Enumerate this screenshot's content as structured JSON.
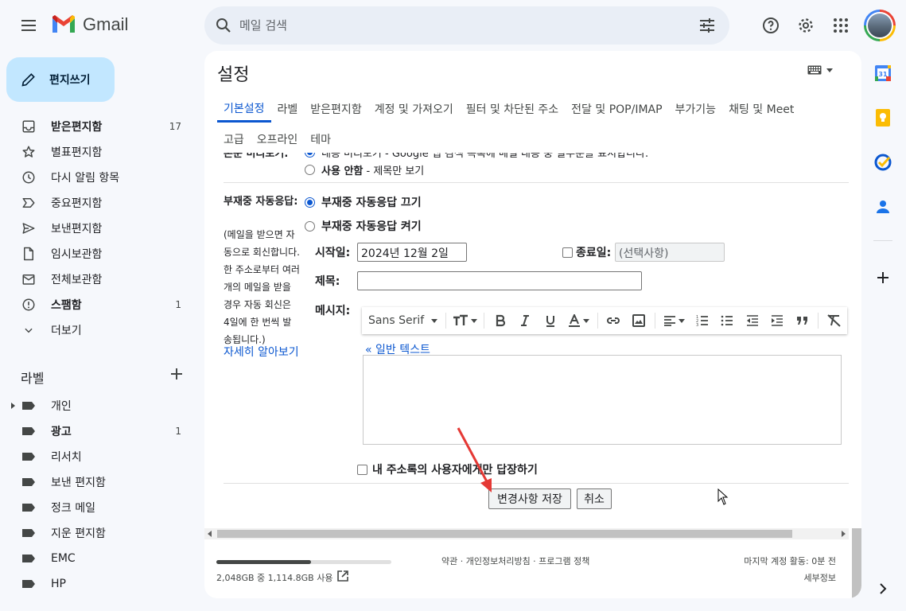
{
  "app": {
    "name": "Gmail"
  },
  "search": {
    "placeholder": "메일 검색"
  },
  "compose": {
    "label": "편지쓰기"
  },
  "nav": [
    {
      "label": "받은편지함",
      "count": "17",
      "bold": true,
      "icon": "inbox-icon"
    },
    {
      "label": "별표편지함",
      "count": "",
      "bold": false,
      "icon": "star-icon"
    },
    {
      "label": "다시 알림 항목",
      "count": "",
      "bold": false,
      "icon": "clock-icon"
    },
    {
      "label": "중요편지함",
      "count": "",
      "bold": false,
      "icon": "important-icon"
    },
    {
      "label": "보낸편지함",
      "count": "",
      "bold": false,
      "icon": "send-icon"
    },
    {
      "label": "임시보관함",
      "count": "",
      "bold": false,
      "icon": "draft-icon"
    },
    {
      "label": "전체보관함",
      "count": "",
      "bold": false,
      "icon": "all-mail-icon"
    },
    {
      "label": "스팸함",
      "count": "1",
      "bold": true,
      "icon": "spam-icon"
    },
    {
      "label": "더보기",
      "count": "",
      "bold": false,
      "icon": "chevron-down-icon"
    }
  ],
  "labels": {
    "heading": "라벨",
    "items": [
      {
        "label": "개인",
        "count": "",
        "bold": false,
        "caret": true
      },
      {
        "label": "광고",
        "count": "1",
        "bold": true,
        "caret": false
      },
      {
        "label": "리서치",
        "count": "",
        "bold": false,
        "caret": false
      },
      {
        "label": "보낸 편지함",
        "count": "",
        "bold": false,
        "caret": false
      },
      {
        "label": "정크 메일",
        "count": "",
        "bold": false,
        "caret": false
      },
      {
        "label": "지운 편지함",
        "count": "",
        "bold": false,
        "caret": false
      },
      {
        "label": "EMC",
        "count": "",
        "bold": false,
        "caret": false
      },
      {
        "label": "HP",
        "count": "",
        "bold": false,
        "caret": false
      }
    ]
  },
  "settings": {
    "title": "설정",
    "tabs_row1": [
      "기본설정",
      "라벨",
      "받은편지함",
      "계정 및 가져오기",
      "필터 및 차단된 주소",
      "전달 및 POP/IMAP",
      "부가기능",
      "채팅 및 Meet"
    ],
    "tabs_row2": [
      "고급",
      "오프라인",
      "테마"
    ],
    "active_tab": "기본설정",
    "preview_partial_label": "본문 미리보기:",
    "preview_on_text": "내용 미리보기 - Google 앱 검색 목록에 메일 내용 중 일부분을 표시합니다.",
    "preview_off_bold": "사용 안함",
    "preview_off_rest": " - 제목만 보기",
    "vacation": {
      "label": "부재중 자동응답:",
      "description": "(메일을 받으면 자동으로 회신합니다. 한 주소로부터 여러 개의 메일을 받을 경우 자동 회신은 4일에 한 번씩 발송됩니다.)",
      "learn_more": "자세히 알아보기",
      "off_option": "부재중 자동응답 끄기",
      "on_option": "부재중 자동응답 켜기",
      "start_label": "시작일:",
      "start_value": "2024년 12월 2일",
      "end_label": "종료일:",
      "end_placeholder": "(선택사항)",
      "subject_label": "제목:",
      "message_label": "메시지:",
      "font": "Sans Serif",
      "plain_text_link": "« 일반 텍스트",
      "contacts_only": "내 주소록의 사용자에게만 답장하기"
    },
    "save_button": "변경사항 저장",
    "cancel_button": "취소"
  },
  "footer": {
    "storage_fraction": 0.54,
    "storage_text": "2,048GB 중 1,114.8GB 사용",
    "links": "약관 · 개인정보처리방침 · 프로그램 정책",
    "last_activity": "마지막 계정 활동: 0분 전",
    "details": "세부정보"
  },
  "colors": {
    "accent": "#0b57d0",
    "compose_bg": "#c2e7ff",
    "annotation_arrow": "#e53935"
  }
}
